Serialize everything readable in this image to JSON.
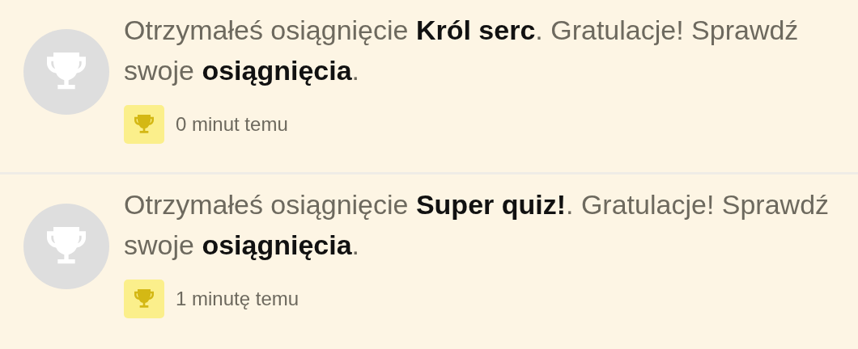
{
  "notifications": [
    {
      "message": "Otrzymałeś osiągnięcie **Król serc**. Gratulacje! Sprawdź swoje **osiągnięcia**.",
      "time": "0 minut temu"
    },
    {
      "message": "Otrzymałeś osiągnięcie **Super quiz!**. Gratulacje! Sprawdź swoje **osiągnięcia**.",
      "time": "1 minutę temu"
    }
  ]
}
